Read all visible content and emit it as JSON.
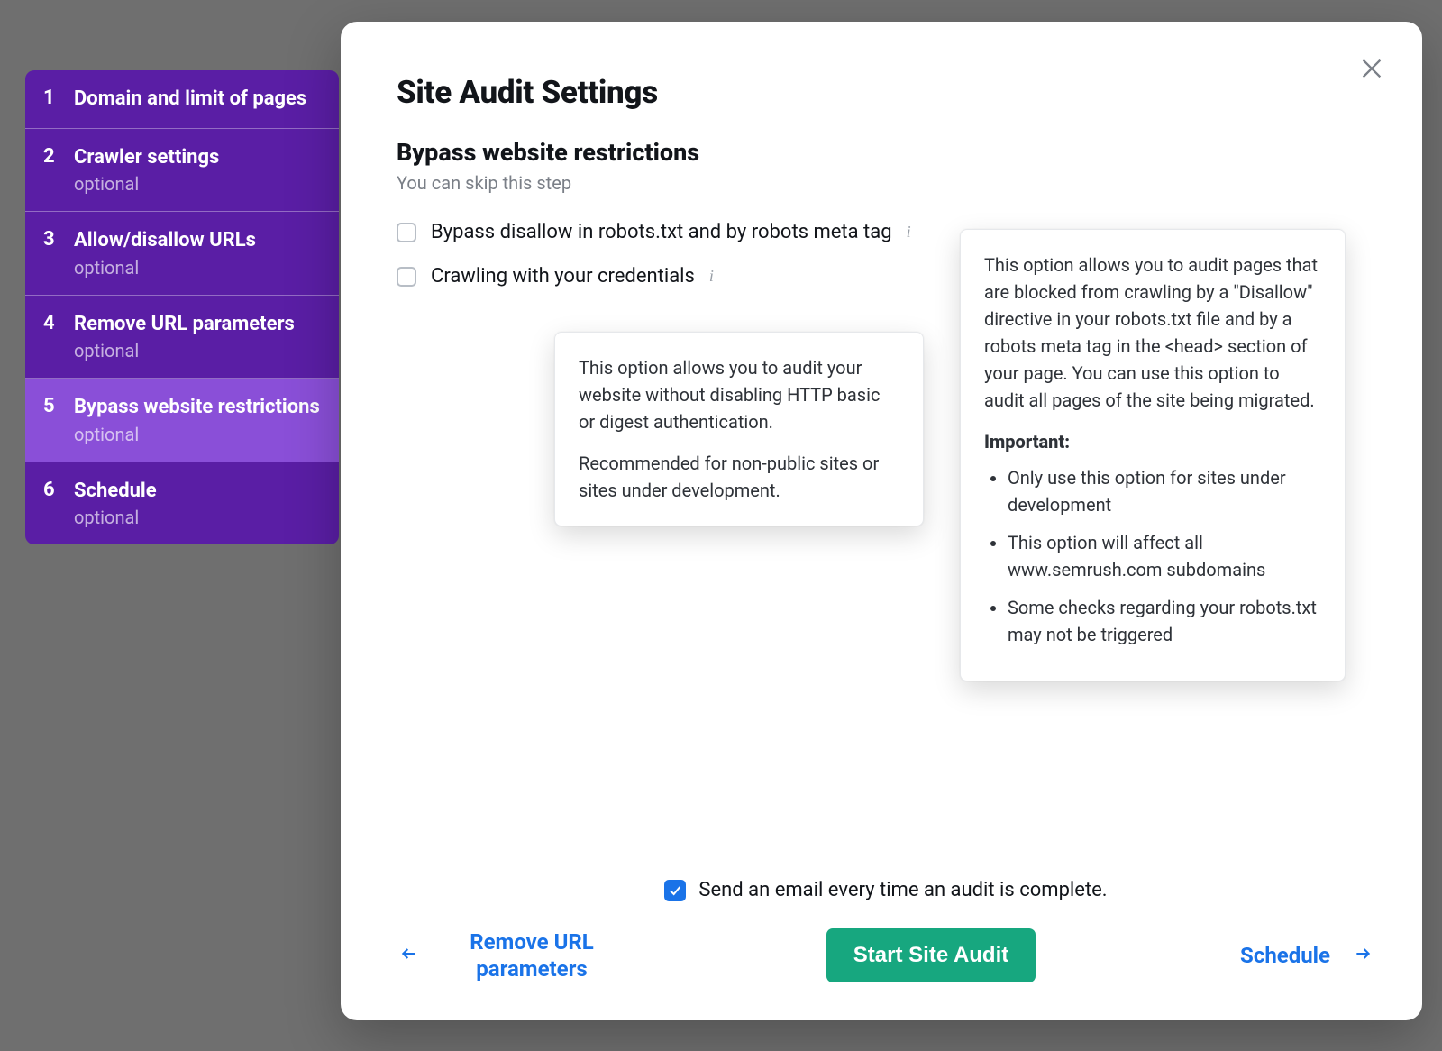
{
  "colors": {
    "sidebar_bg": "#5a1ea5",
    "sidebar_active": "#8a4fd8",
    "primary_button": "#17a77f",
    "link": "#1a73e8"
  },
  "sidebar": {
    "items": [
      {
        "num": "1",
        "label": "Domain and limit of pages",
        "optional": ""
      },
      {
        "num": "2",
        "label": "Crawler settings",
        "optional": "optional"
      },
      {
        "num": "3",
        "label": "Allow/disallow URLs",
        "optional": "optional"
      },
      {
        "num": "4",
        "label": "Remove URL parameters",
        "optional": "optional"
      },
      {
        "num": "5",
        "label": "Bypass website restrictions",
        "optional": "optional"
      },
      {
        "num": "6",
        "label": "Schedule",
        "optional": "optional"
      }
    ]
  },
  "modal": {
    "title": "Site Audit Settings",
    "section_title": "Bypass website restrictions",
    "section_sub": "You can skip this step",
    "opt1_label": "Bypass disallow in robots.txt and by robots meta tag",
    "opt2_label": "Crawling with your credentials"
  },
  "tooltip_left": {
    "p1": "This option allows you to audit your website without disabling HTTP basic or digest authentication.",
    "p2": "Recommended for non-public sites or sites under development."
  },
  "tooltip_right": {
    "p1": "This option allows you to audit pages that are blocked from crawling by a \"Disallow\" directive in your robots.txt file and by a robots meta tag in the <head> section of your page. You can use this option to audit all pages of the site being migrated.",
    "important_label": "Important:",
    "bullets": [
      "Only use this option for sites under development",
      "This option will affect all www.semrush.com subdomains",
      "Some checks regarding your robots.txt may not be triggered"
    ]
  },
  "footer": {
    "email_label": "Send an email every time an audit is complete.",
    "back_label": "Remove URL parameters",
    "primary_label": "Start Site Audit",
    "next_label": "Schedule"
  }
}
